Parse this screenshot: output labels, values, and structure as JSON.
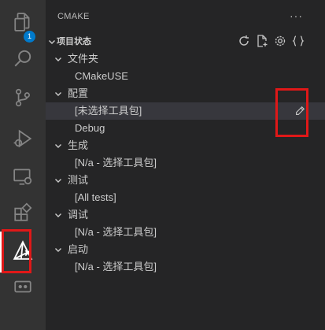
{
  "activity_bar": {
    "explorer_badge": "1",
    "items": [
      {
        "icon": "files-icon"
      },
      {
        "icon": "search-icon"
      },
      {
        "icon": "source-control-icon"
      },
      {
        "icon": "run-debug-icon"
      },
      {
        "icon": "remote-explorer-icon"
      },
      {
        "icon": "extensions-icon"
      },
      {
        "icon": "cmake-icon"
      },
      {
        "icon": "remote-icon"
      }
    ]
  },
  "sidebar": {
    "title": "CMAKE",
    "more_label": "···",
    "section_title": "项目状态",
    "toolbar_icons": [
      "refresh-icon",
      "new-file-icon",
      "settings-icon",
      "braces-icon"
    ],
    "tree": [
      {
        "label": "文件夹",
        "level": 1,
        "expanded": true
      },
      {
        "label": "CMakeUSE",
        "level": 2
      },
      {
        "label": "配置",
        "level": 1,
        "expanded": true
      },
      {
        "label": "[未选择工具包]",
        "level": 2,
        "selected": true,
        "action_icon": "pencil-icon"
      },
      {
        "label": "Debug",
        "level": 2
      },
      {
        "label": "生成",
        "level": 1,
        "expanded": true
      },
      {
        "label": "[N/a - 选择工具包]",
        "level": 2
      },
      {
        "label": "测试",
        "level": 1,
        "expanded": true
      },
      {
        "label": "[All tests]",
        "level": 2
      },
      {
        "label": "调试",
        "level": 1,
        "expanded": true
      },
      {
        "label": "[N/a - 选择工具包]",
        "level": 2
      },
      {
        "label": "启动",
        "level": 1,
        "expanded": true
      },
      {
        "label": "[N/a - 选择工具包]",
        "level": 2
      }
    ]
  },
  "colors": {
    "activity_bar_bg": "#333333",
    "sidebar_bg": "#252526",
    "badge": "#007acc",
    "highlight_box": "#e01818"
  }
}
